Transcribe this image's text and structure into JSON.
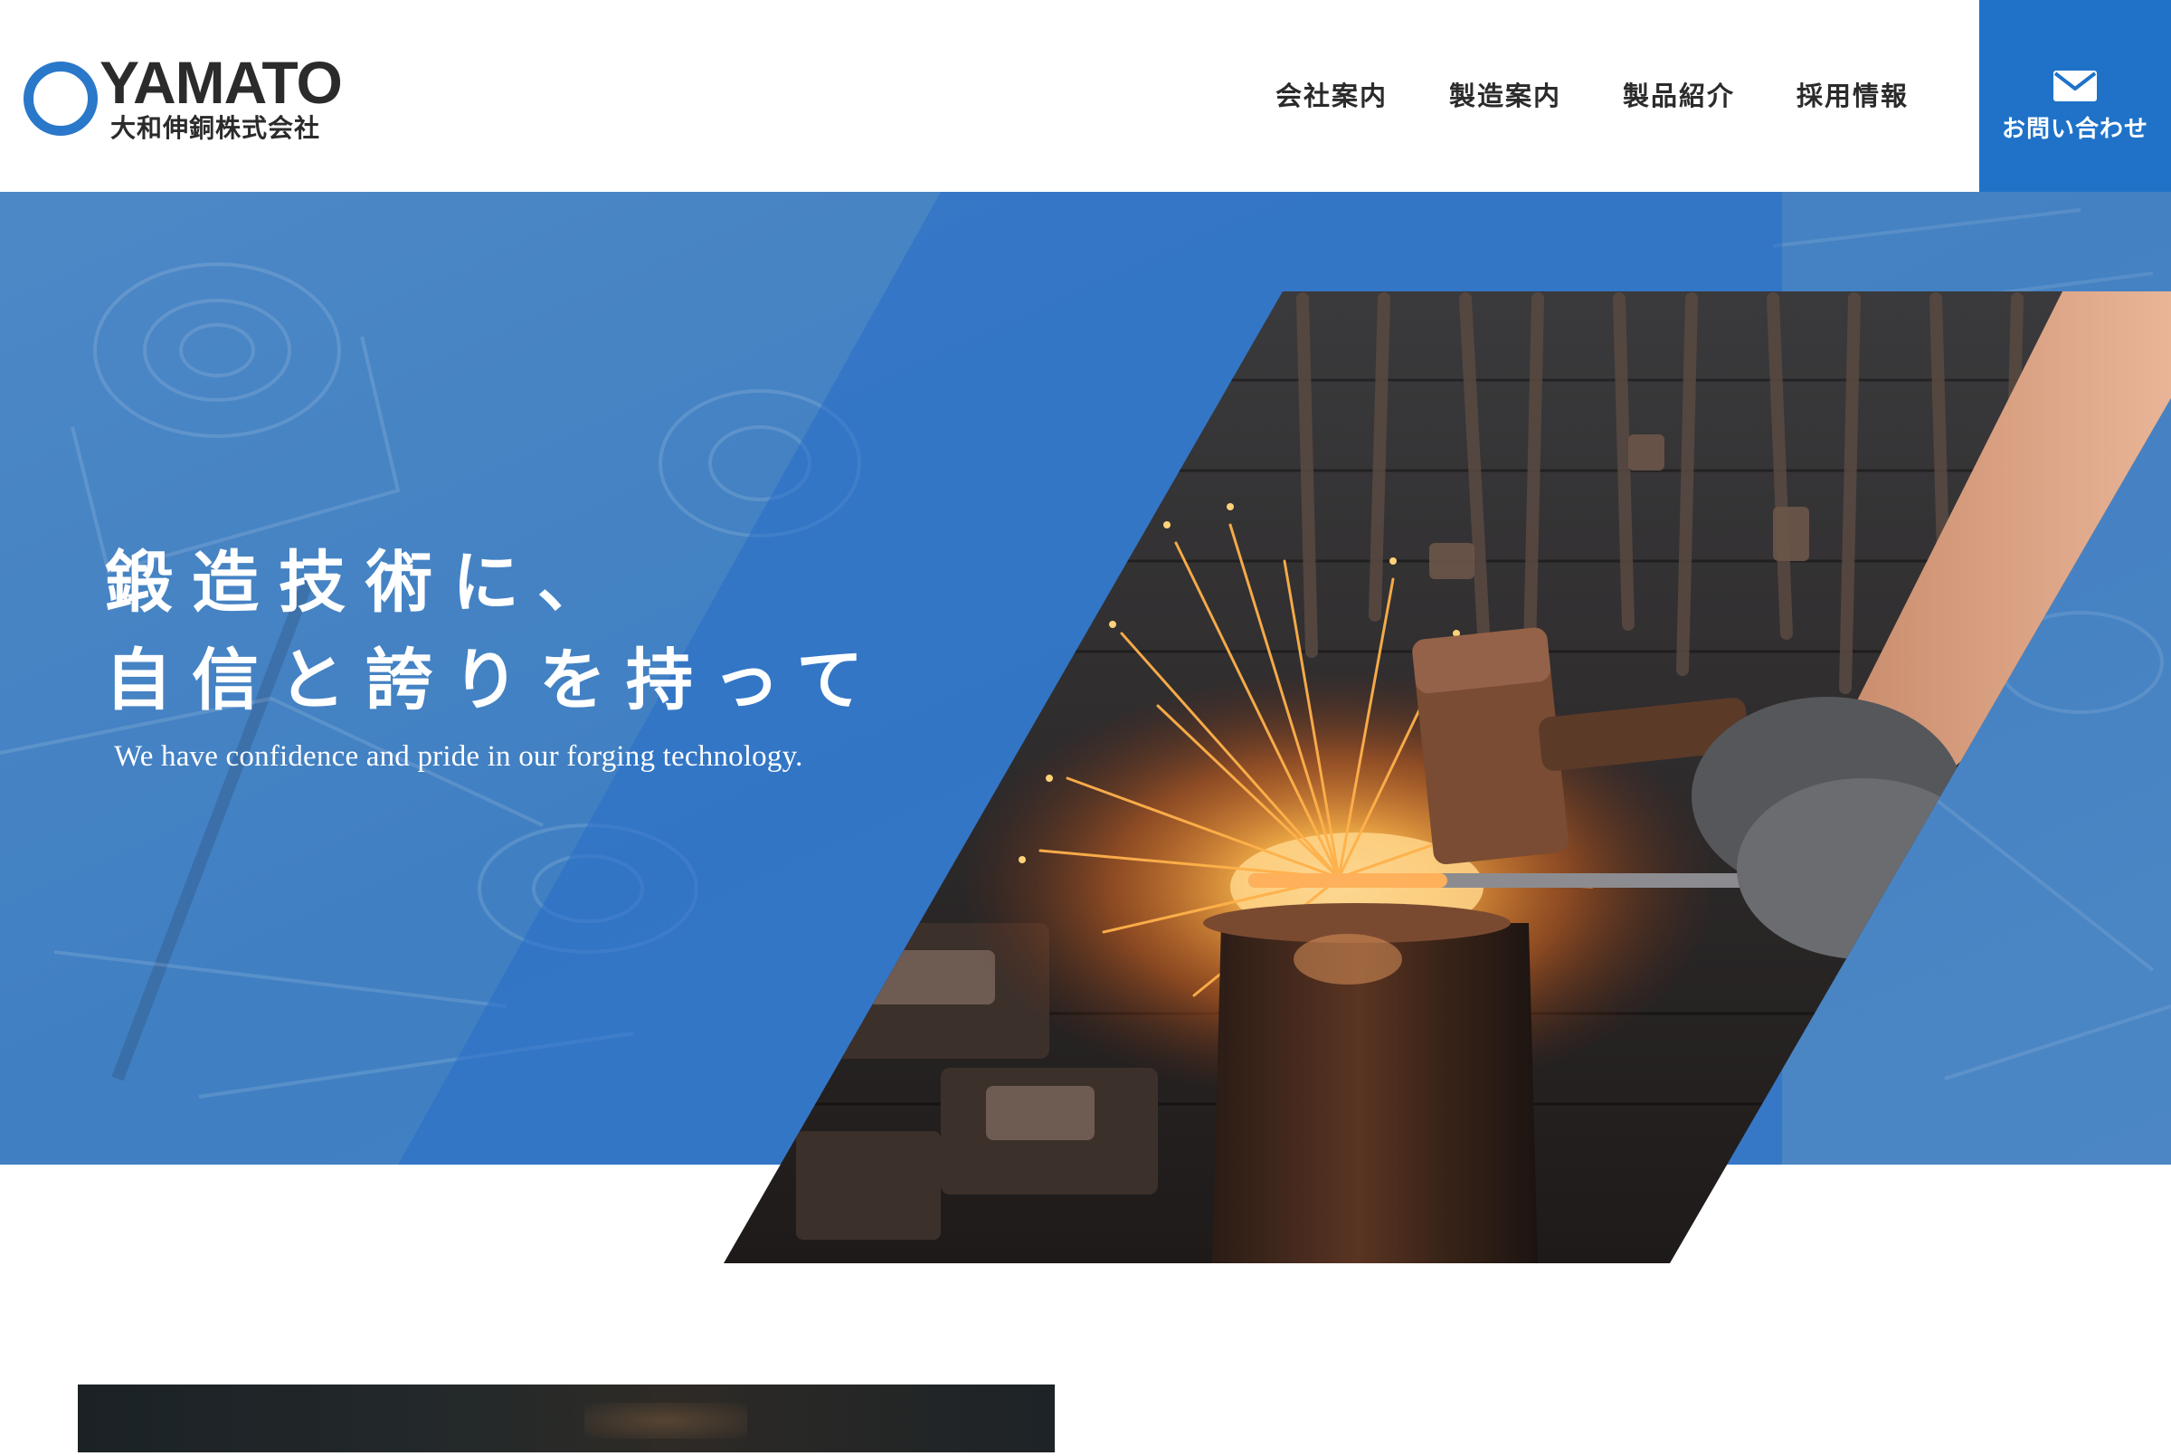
{
  "header": {
    "logo": {
      "name_en": "YAMATO",
      "name_ja": "大和伸銅株式会社"
    },
    "nav": [
      {
        "label": "会社案内"
      },
      {
        "label": "製造案内"
      },
      {
        "label": "製品紹介"
      },
      {
        "label": "採用情報"
      }
    ],
    "contact": {
      "label": "お問い合わせ",
      "icon": "mail-icon"
    }
  },
  "hero": {
    "headline_line1": "鍛造技術に、",
    "headline_line2": "自信と誇りを持って",
    "subtitle": "We have confidence and pride in our forging technology."
  },
  "colors": {
    "brand_blue": "#1f72c8",
    "hero_blue": "#3f7fc2",
    "text_dark": "#2b2b2b"
  }
}
